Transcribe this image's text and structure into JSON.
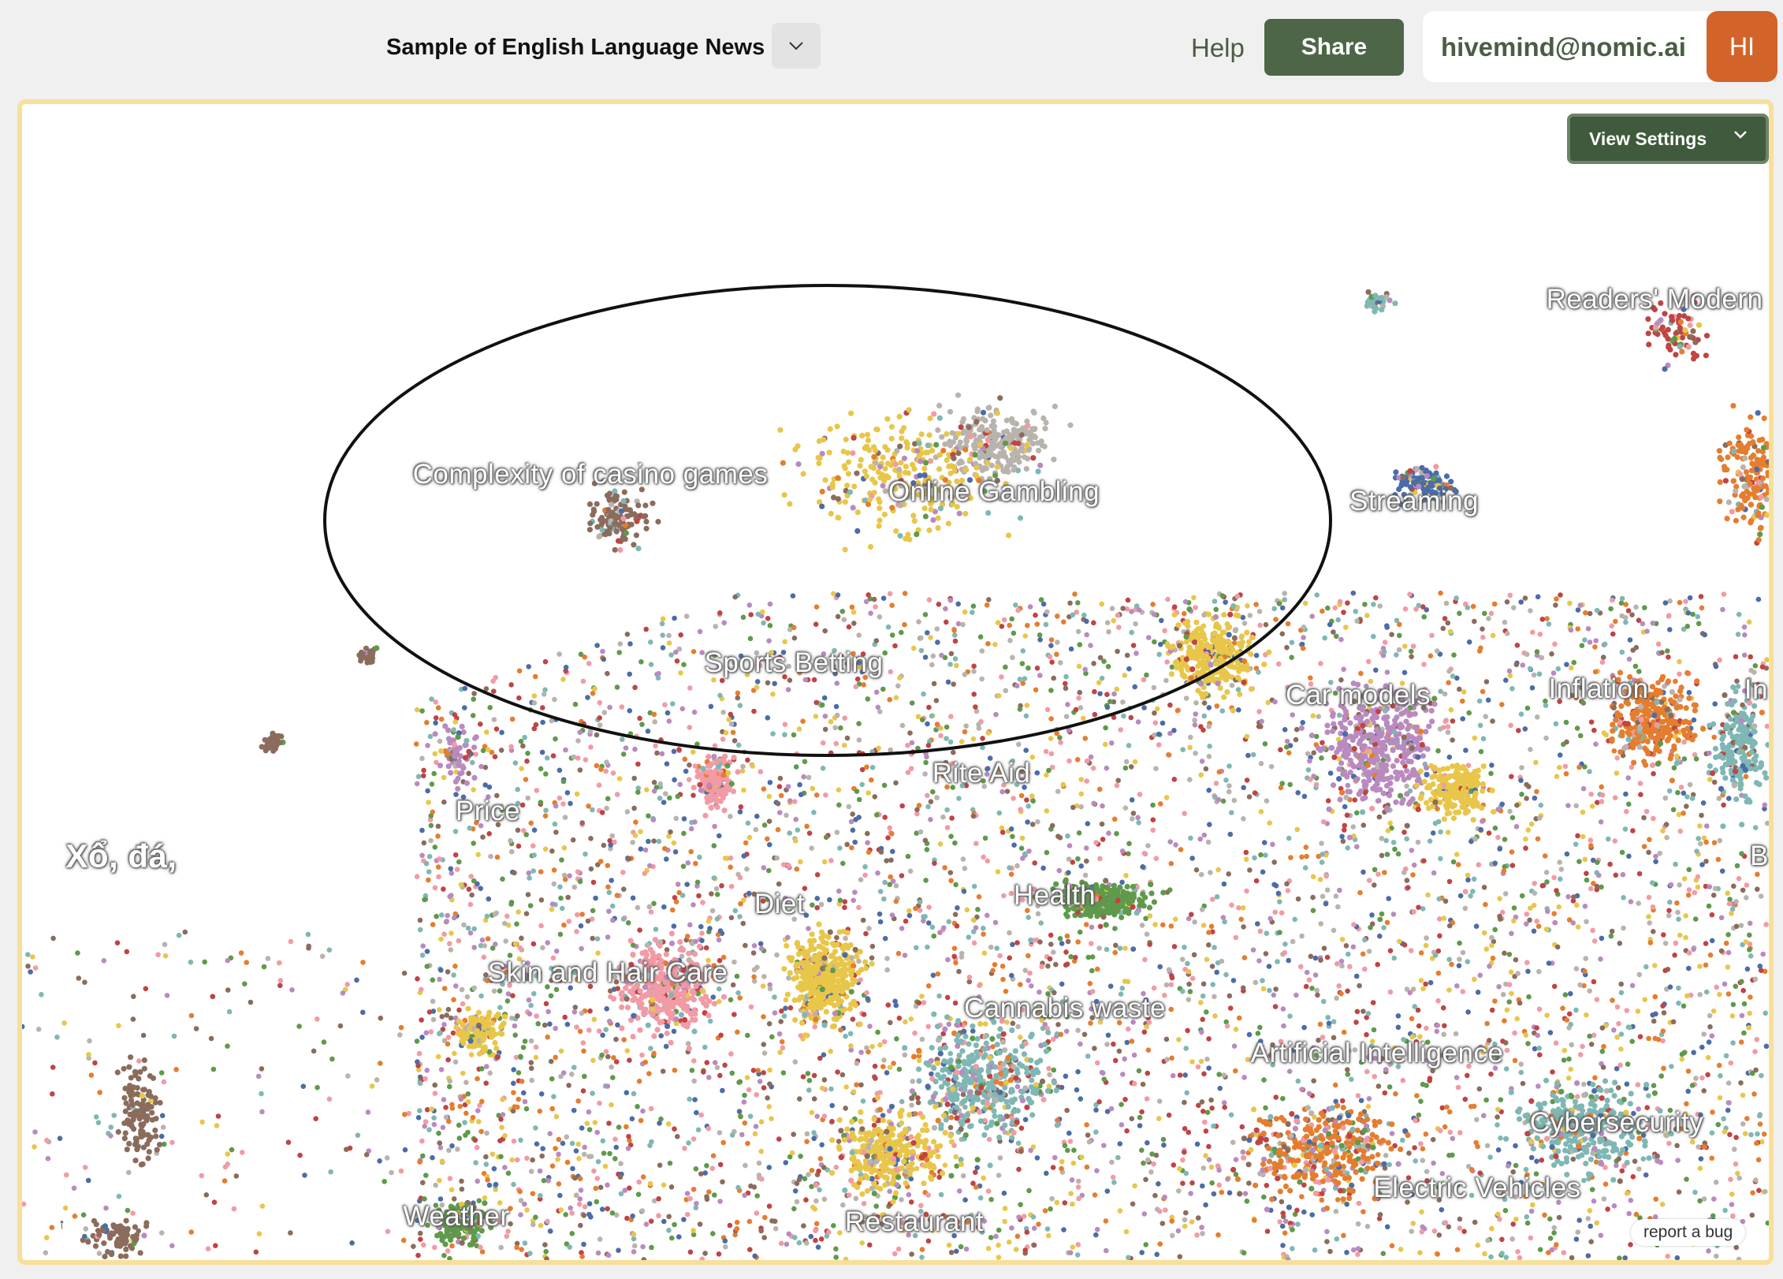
{
  "header": {
    "title": "Sample of English Language News",
    "dropdown_icon": "chevron-down-icon",
    "help_label": "Help",
    "share_label": "Share",
    "user_email": "hivemind@nomic.ai",
    "avatar_initials": "HI"
  },
  "map": {
    "view_settings_label": "View Settings",
    "report_bug_label": "report a bug",
    "colors": [
      "#e8c64a",
      "#5e9a4a",
      "#f29aa5",
      "#b98ac0",
      "#7fb7b4",
      "#8b6c5c",
      "#4c6ca8",
      "#e57d2f",
      "#c04444",
      "#b8b3ad"
    ],
    "topic_labels": [
      {
        "text": "Readers' Modern"
      },
      {
        "text": "Complexity of casino games"
      },
      {
        "text": "Online Gambling"
      },
      {
        "text": "Streaming"
      },
      {
        "text": "Sports Betting"
      },
      {
        "text": "Car models"
      },
      {
        "text": "Inflation"
      },
      {
        "text": "In"
      },
      {
        "text": "Rite Aid"
      },
      {
        "text": "Price"
      },
      {
        "text": "Xổ, đá,"
      },
      {
        "text": "B"
      },
      {
        "text": "Diet"
      },
      {
        "text": "Health"
      },
      {
        "text": "Skin and Hair Care"
      },
      {
        "text": "Cannabis waste"
      },
      {
        "text": "Artificial Intelligence"
      },
      {
        "text": "Cybersecurity"
      },
      {
        "text": "Electric Vehicles"
      },
      {
        "text": "Weather"
      },
      {
        "text": "Restaurant"
      }
    ]
  }
}
